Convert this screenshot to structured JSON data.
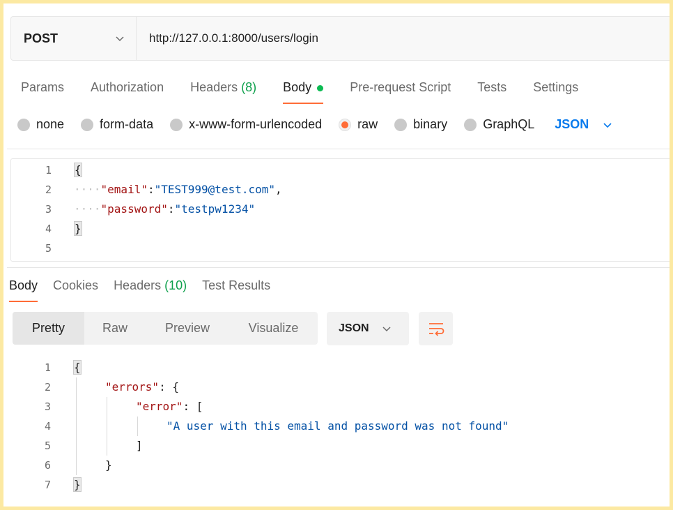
{
  "request": {
    "method": "POST",
    "url": "http://127.0.0.1:8000/users/login"
  },
  "request_tabs": [
    {
      "label": "Params"
    },
    {
      "label": "Authorization"
    },
    {
      "label": "Headers",
      "count": "(8)"
    },
    {
      "label": "Body"
    },
    {
      "label": "Pre-request Script"
    },
    {
      "label": "Tests"
    },
    {
      "label": "Settings"
    }
  ],
  "body_types": [
    "none",
    "form-data",
    "x-www-form-urlencoded",
    "raw",
    "binary",
    "GraphQL"
  ],
  "body_selected": "raw",
  "body_format": "JSON",
  "request_body": {
    "line_numbers": [
      "1",
      "2",
      "3",
      "4",
      "5"
    ],
    "open_brace": "{",
    "close_brace": "}",
    "email_key": "\"email\"",
    "email_value": "\"TEST999@test.com\"",
    "password_key": "\"password\"",
    "password_value": "\"testpw1234\""
  },
  "response_tabs": [
    {
      "label": "Body"
    },
    {
      "label": "Cookies"
    },
    {
      "label": "Headers",
      "count": "(10)"
    },
    {
      "label": "Test Results"
    }
  ],
  "view_modes": [
    "Pretty",
    "Raw",
    "Preview",
    "Visualize"
  ],
  "response_format": "JSON",
  "response_body": {
    "line_numbers": [
      "1",
      "2",
      "3",
      "4",
      "5",
      "6",
      "7"
    ],
    "open_brace": "{",
    "close_brace": "}",
    "errors_key": "\"errors\"",
    "error_key": "\"error\"",
    "message": "\"A user with this email and password was not found\"",
    "close_bracket": "]",
    "inner_close_brace": "}"
  },
  "colors": {
    "accent": "#ff6c37",
    "count_green": "#0ea04c",
    "json_blue": "#097bed",
    "frame_border": "#fce9a2"
  }
}
